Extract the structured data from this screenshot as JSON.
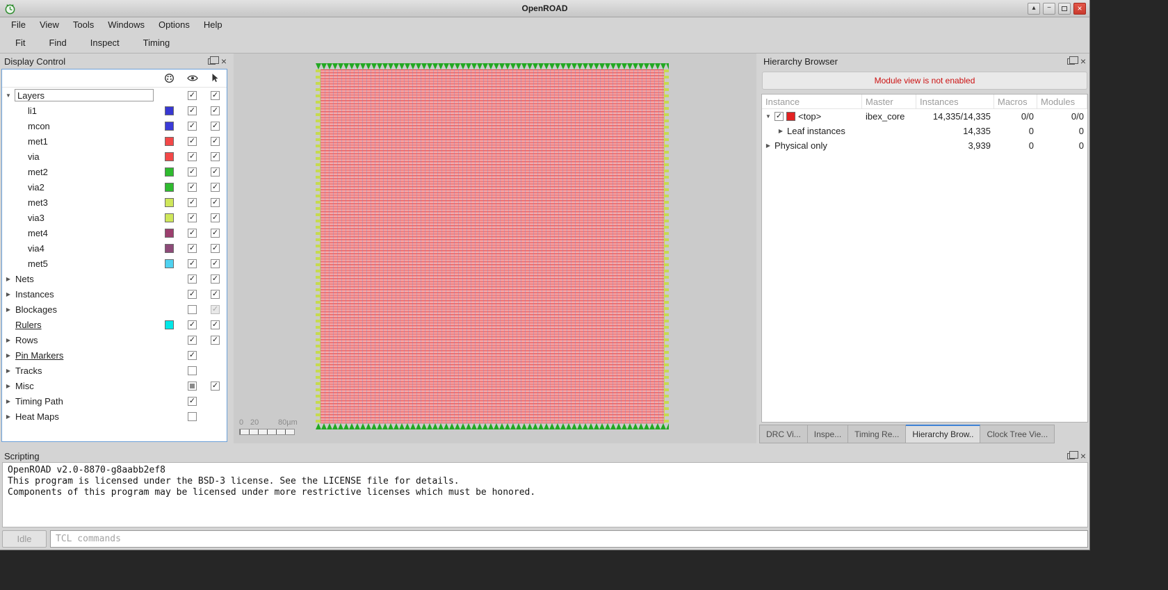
{
  "window": {
    "title": "OpenROAD",
    "menu": [
      "File",
      "View",
      "Tools",
      "Windows",
      "Options",
      "Help"
    ],
    "toolbar": [
      "Fit",
      "Find",
      "Inspect",
      "Timing"
    ]
  },
  "display_control": {
    "title": "Display Control",
    "columns": [
      "color",
      "visible",
      "selectable"
    ],
    "rows": [
      {
        "label": "Layers",
        "depth": 0,
        "arrow": "expanded",
        "vis": "checked",
        "sel": "checked",
        "boxed": true
      },
      {
        "label": "li1",
        "depth": 1,
        "swatch": "#3737d2",
        "vis": "checked",
        "sel": "checked"
      },
      {
        "label": "mcon",
        "depth": 1,
        "swatch": "#3b3bd8",
        "vis": "checked",
        "sel": "checked"
      },
      {
        "label": "met1",
        "depth": 1,
        "swatch": "#f34848",
        "vis": "checked",
        "sel": "checked"
      },
      {
        "label": "via",
        "depth": 1,
        "swatch": "#f34848",
        "vis": "checked",
        "sel": "checked"
      },
      {
        "label": "met2",
        "depth": 1,
        "swatch": "#2fbb2f",
        "vis": "checked",
        "sel": "checked"
      },
      {
        "label": "via2",
        "depth": 1,
        "swatch": "#2fbb2f",
        "vis": "checked",
        "sel": "checked"
      },
      {
        "label": "met3",
        "depth": 1,
        "swatch": "#cfe75a",
        "vis": "checked",
        "sel": "checked"
      },
      {
        "label": "via3",
        "depth": 1,
        "swatch": "#cfe75a",
        "vis": "checked",
        "sel": "checked"
      },
      {
        "label": "met4",
        "depth": 1,
        "swatch": "#9c3f6e",
        "vis": "checked",
        "sel": "checked"
      },
      {
        "label": "via4",
        "depth": 1,
        "swatch": "#8d4a78",
        "vis": "checked",
        "sel": "checked"
      },
      {
        "label": "met5",
        "depth": 1,
        "swatch": "#4fd2f0",
        "vis": "checked",
        "sel": "checked"
      },
      {
        "label": "Nets",
        "depth": 0,
        "arrow": "collapsed",
        "vis": "checked",
        "sel": "checked"
      },
      {
        "label": "Instances",
        "depth": 0,
        "arrow": "collapsed",
        "vis": "checked",
        "sel": "checked"
      },
      {
        "label": "Blockages",
        "depth": 0,
        "arrow": "collapsed",
        "vis": "unchecked",
        "sel": "dim"
      },
      {
        "label": "Rulers",
        "depth": 0,
        "underline": true,
        "swatch": "#00e8e8",
        "vis": "checked",
        "sel": "checked"
      },
      {
        "label": "Rows",
        "depth": 0,
        "arrow": "collapsed",
        "vis": "checked",
        "sel": "checked"
      },
      {
        "label": "Pin Markers",
        "depth": 0,
        "arrow": "collapsed",
        "underline": true,
        "vis": "checked"
      },
      {
        "label": "Tracks",
        "depth": 0,
        "arrow": "collapsed",
        "vis": "unchecked"
      },
      {
        "label": "Misc",
        "depth": 0,
        "arrow": "collapsed",
        "vis": "partial",
        "sel": "checked"
      },
      {
        "label": "Timing Path",
        "depth": 0,
        "arrow": "collapsed",
        "vis": "checked"
      },
      {
        "label": "Heat Maps",
        "depth": 0,
        "arrow": "collapsed",
        "vis": "unchecked"
      }
    ]
  },
  "viewer": {
    "scale_labels": [
      {
        "text": "0",
        "x": 0
      },
      {
        "text": "20",
        "x": 16
      },
      {
        "text": "80µm",
        "x": 56
      }
    ],
    "colors": {
      "rail_red": "#e83a3a",
      "pin_green": "#22a822",
      "pin_side": "#c6da4f",
      "grid_blue": "#6086db"
    }
  },
  "hierarchy": {
    "title": "Hierarchy Browser",
    "banner": "Module view is not enabled",
    "banner_color": "#cc1111",
    "columns": [
      "Instance",
      "Master",
      "Instances",
      "Macros",
      "Modules"
    ],
    "rows": [
      {
        "name": "<top>",
        "depth": 0,
        "arrow": "expanded",
        "checked": true,
        "swatch": "#e32222",
        "master": "ibex_core",
        "instances": "14,335/14,335",
        "macros": "0/0",
        "modules": "0/0"
      },
      {
        "name": "Leaf instances",
        "depth": 1,
        "arrow": "collapsed",
        "master": "",
        "instances": "14,335",
        "macros": "0",
        "modules": "0"
      },
      {
        "name": "Physical only",
        "depth": 0,
        "arrow": "collapsed",
        "master": "",
        "instances": "3,939",
        "macros": "0",
        "modules": "0"
      }
    ],
    "tabs": [
      {
        "label": "DRC Vi...",
        "active": false
      },
      {
        "label": "Inspe...",
        "active": false
      },
      {
        "label": "Timing Re...",
        "active": false
      },
      {
        "label": "Hierarchy Brow..",
        "active": true
      },
      {
        "label": "Clock Tree Vie...",
        "active": false
      }
    ]
  },
  "scripting": {
    "title": "Scripting",
    "lines": [
      "OpenROAD v2.0-8870-g8aabb2ef8",
      "This program is licensed under the BSD-3 license. See the LICENSE file for details.",
      "Components of this program may be licensed under more restrictive licenses which must be honored."
    ],
    "status": "Idle",
    "input_placeholder": "TCL commands"
  }
}
